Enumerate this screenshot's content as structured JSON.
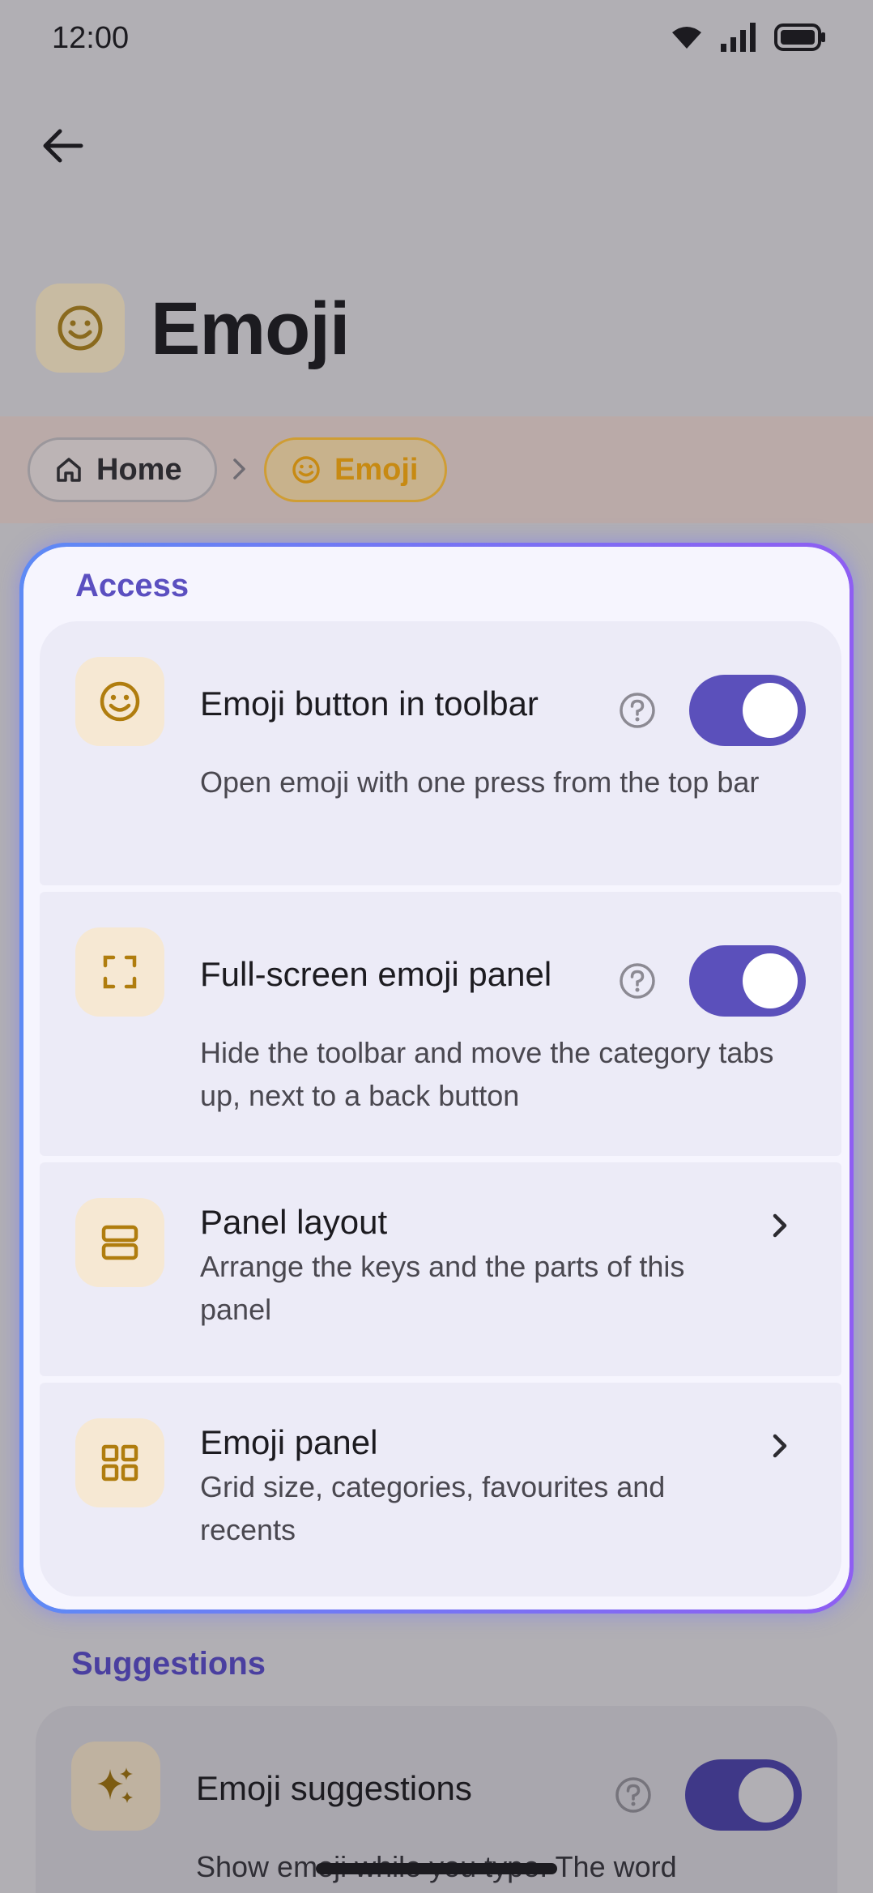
{
  "status_bar": {
    "time": "12:00"
  },
  "header": {
    "title": "Emoji"
  },
  "breadcrumb": {
    "home": "Home",
    "current": "Emoji"
  },
  "access": {
    "section_title": "Access",
    "items": [
      {
        "title": "Emoji button in toolbar",
        "description": "Open emoji with one press from the top bar",
        "toggle": "on"
      },
      {
        "title": "Full-screen emoji panel",
        "description": "Hide the toolbar and move the category tabs up, next to a back button",
        "toggle": "on"
      },
      {
        "title": "Panel layout",
        "description": "Arrange the keys and the parts of this panel"
      },
      {
        "title": "Emoji panel",
        "description": "Grid size, categories, favourites and recents"
      }
    ]
  },
  "suggestions": {
    "section_title": "Suggestions",
    "items": [
      {
        "title": "Emoji suggestions",
        "description": "Show emoji while you type. The word",
        "toggle": "on"
      }
    ]
  },
  "colors": {
    "accent": "#5b50bb",
    "section": "#5b4fc0",
    "icon_tint": "#b07d0e",
    "icon_bg": "#f6e8d3"
  }
}
